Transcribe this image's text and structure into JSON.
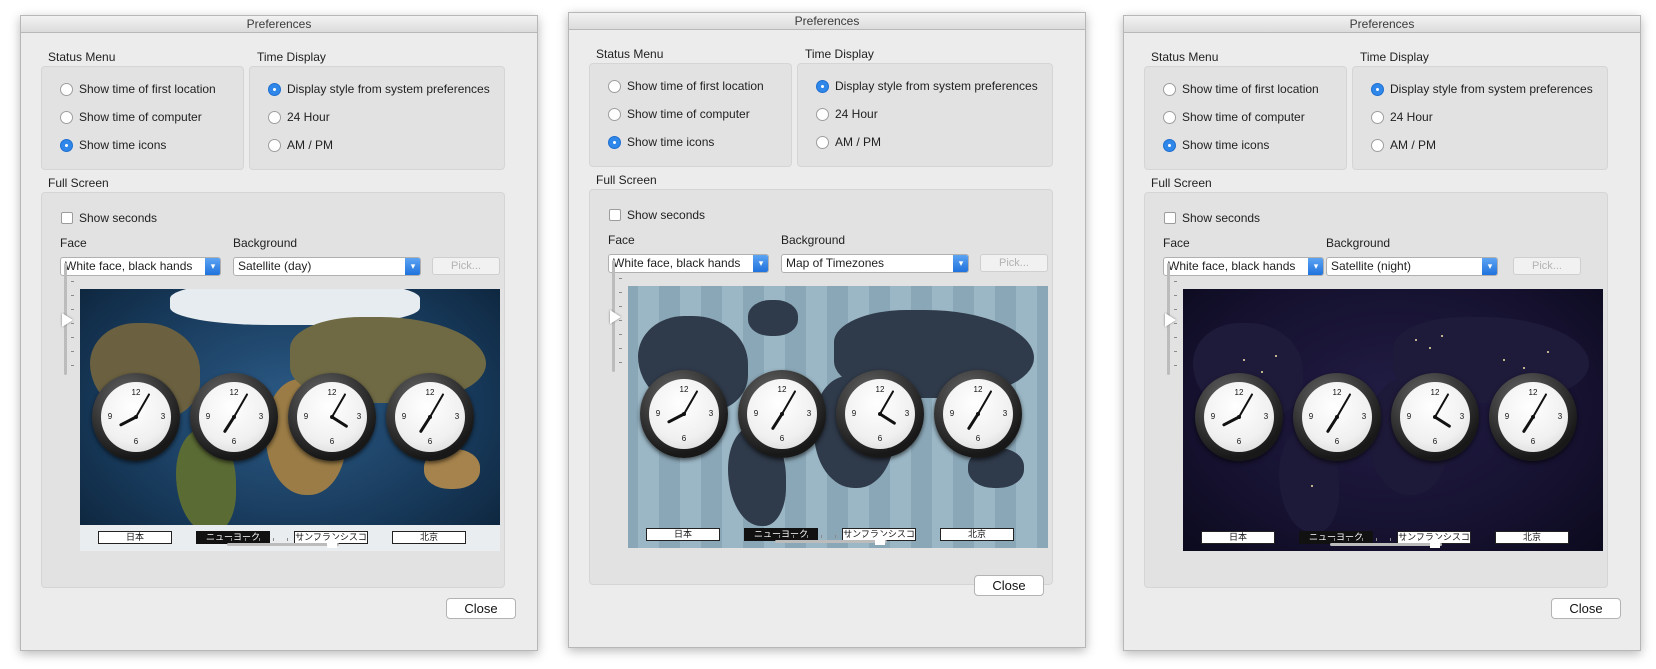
{
  "windows": [
    {
      "title": "Preferences",
      "status_menu": {
        "heading": "Status Menu",
        "options": [
          "Show time of first location",
          "Show time of computer",
          "Show time icons"
        ],
        "selected_index": 2
      },
      "time_display": {
        "heading": "Time Display",
        "options": [
          "Display style from system preferences",
          "24 Hour",
          "AM / PM"
        ],
        "selected_index": 0
      },
      "full_screen": {
        "heading": "Full Screen",
        "show_seconds_label": "Show seconds",
        "show_seconds_checked": false,
        "face_label": "Face",
        "face_value": "White face, black hands",
        "background_label": "Background",
        "background_value": "Satellite (day)",
        "pick_label": "Pick...",
        "preview_style": "satellite-day",
        "cities": [
          "日本",
          "ニューヨーク",
          "サンフランシスコ",
          "北京"
        ],
        "highlighted_city_index": 1
      },
      "close_label": "Close"
    },
    {
      "title": "Preferences",
      "status_menu": {
        "heading": "Status Menu",
        "options": [
          "Show time of first location",
          "Show time of computer",
          "Show time icons"
        ],
        "selected_index": 2
      },
      "time_display": {
        "heading": "Time Display",
        "options": [
          "Display style from system preferences",
          "24 Hour",
          "AM / PM"
        ],
        "selected_index": 0
      },
      "full_screen": {
        "heading": "Full Screen",
        "show_seconds_label": "Show seconds",
        "show_seconds_checked": false,
        "face_label": "Face",
        "face_value": "White face, black hands",
        "background_label": "Background",
        "background_value": "Map of Timezones",
        "pick_label": "Pick...",
        "preview_style": "timezones",
        "cities": [
          "日本",
          "ニューヨーク",
          "サンフランシスコ",
          "北京"
        ],
        "highlighted_city_index": 1
      },
      "close_label": "Close"
    },
    {
      "title": "Preferences",
      "status_menu": {
        "heading": "Status Menu",
        "options": [
          "Show time of first location",
          "Show time of computer",
          "Show time icons"
        ],
        "selected_index": 2
      },
      "time_display": {
        "heading": "Time Display",
        "options": [
          "Display style from system preferences",
          "24 Hour",
          "AM / PM"
        ],
        "selected_index": 0
      },
      "full_screen": {
        "heading": "Full Screen",
        "show_seconds_label": "Show seconds",
        "show_seconds_checked": false,
        "face_label": "Face",
        "face_value": "White face, black hands",
        "background_label": "Background",
        "background_value": "Satellite (night)",
        "pick_label": "Pick...",
        "preview_style": "satellite-night",
        "cities": [
          "日本",
          "ニューヨーク",
          "サンフランシスコ",
          "北京"
        ],
        "highlighted_city_index": 1
      },
      "close_label": "Close"
    }
  ],
  "clock_times": [
    {
      "hour": 8,
      "minute": 5
    },
    {
      "hour": 7,
      "minute": 5
    },
    {
      "hour": 4,
      "minute": 5
    },
    {
      "hour": 7,
      "minute": 5
    }
  ],
  "colors": {
    "accent": "#2f87ea",
    "window_bg": "#ececec",
    "group_bg": "#e2e2e2"
  }
}
